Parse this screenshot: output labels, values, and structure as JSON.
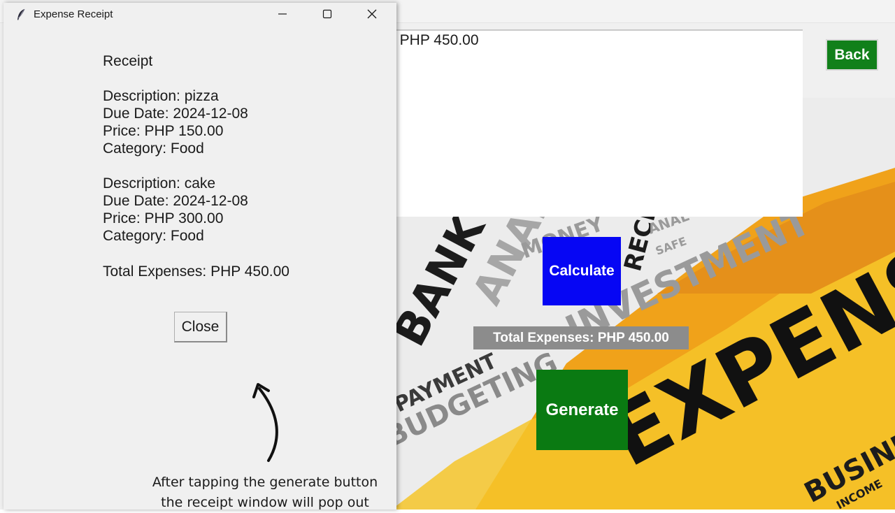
{
  "main_window": {
    "output_text": ": PHP 450.00",
    "back_label": "Back",
    "calculate_label": "Calculate",
    "total_label": "Total Expenses: PHP 450.00",
    "generate_label": "Generate",
    "background_image": {
      "words": [
        "BANK",
        "ANALYSIS",
        "MONEY",
        "RECEIPT",
        "ANAL",
        "SAFE",
        "INVESTMENT",
        "PAYMENT",
        "BUDGETING",
        "EXPENSES",
        "BUSINE",
        "INCOME"
      ],
      "colors": {
        "orange": "#f0a21a",
        "yellow": "#f6c52a",
        "ink": "#111111",
        "gray": "#9a9a9a"
      }
    },
    "colors": {
      "calculate": "#0606f4",
      "generate": "#0a7a12",
      "back": "#11801a",
      "total_bg": "#8c8c8c"
    }
  },
  "receipt_window": {
    "title": "Expense Receipt",
    "controls": {
      "minimize": "minimize-icon",
      "maximize": "maximize-icon",
      "close": "close-icon"
    },
    "heading": "Receipt",
    "items": [
      {
        "description": "Description: pizza",
        "due_date": "Due Date: 2024-12-08",
        "price": "Price: PHP 150.00",
        "category": "Category: Food"
      },
      {
        "description": "Description: cake",
        "due_date": "Due Date: 2024-12-08",
        "price": "Price: PHP 300.00",
        "category": "Category: Food"
      }
    ],
    "total": "Total Expenses: PHP 450.00",
    "close_label": "Close"
  },
  "annotation": {
    "line1": "After tapping the generate button",
    "line2": "the receipt window will pop out"
  }
}
